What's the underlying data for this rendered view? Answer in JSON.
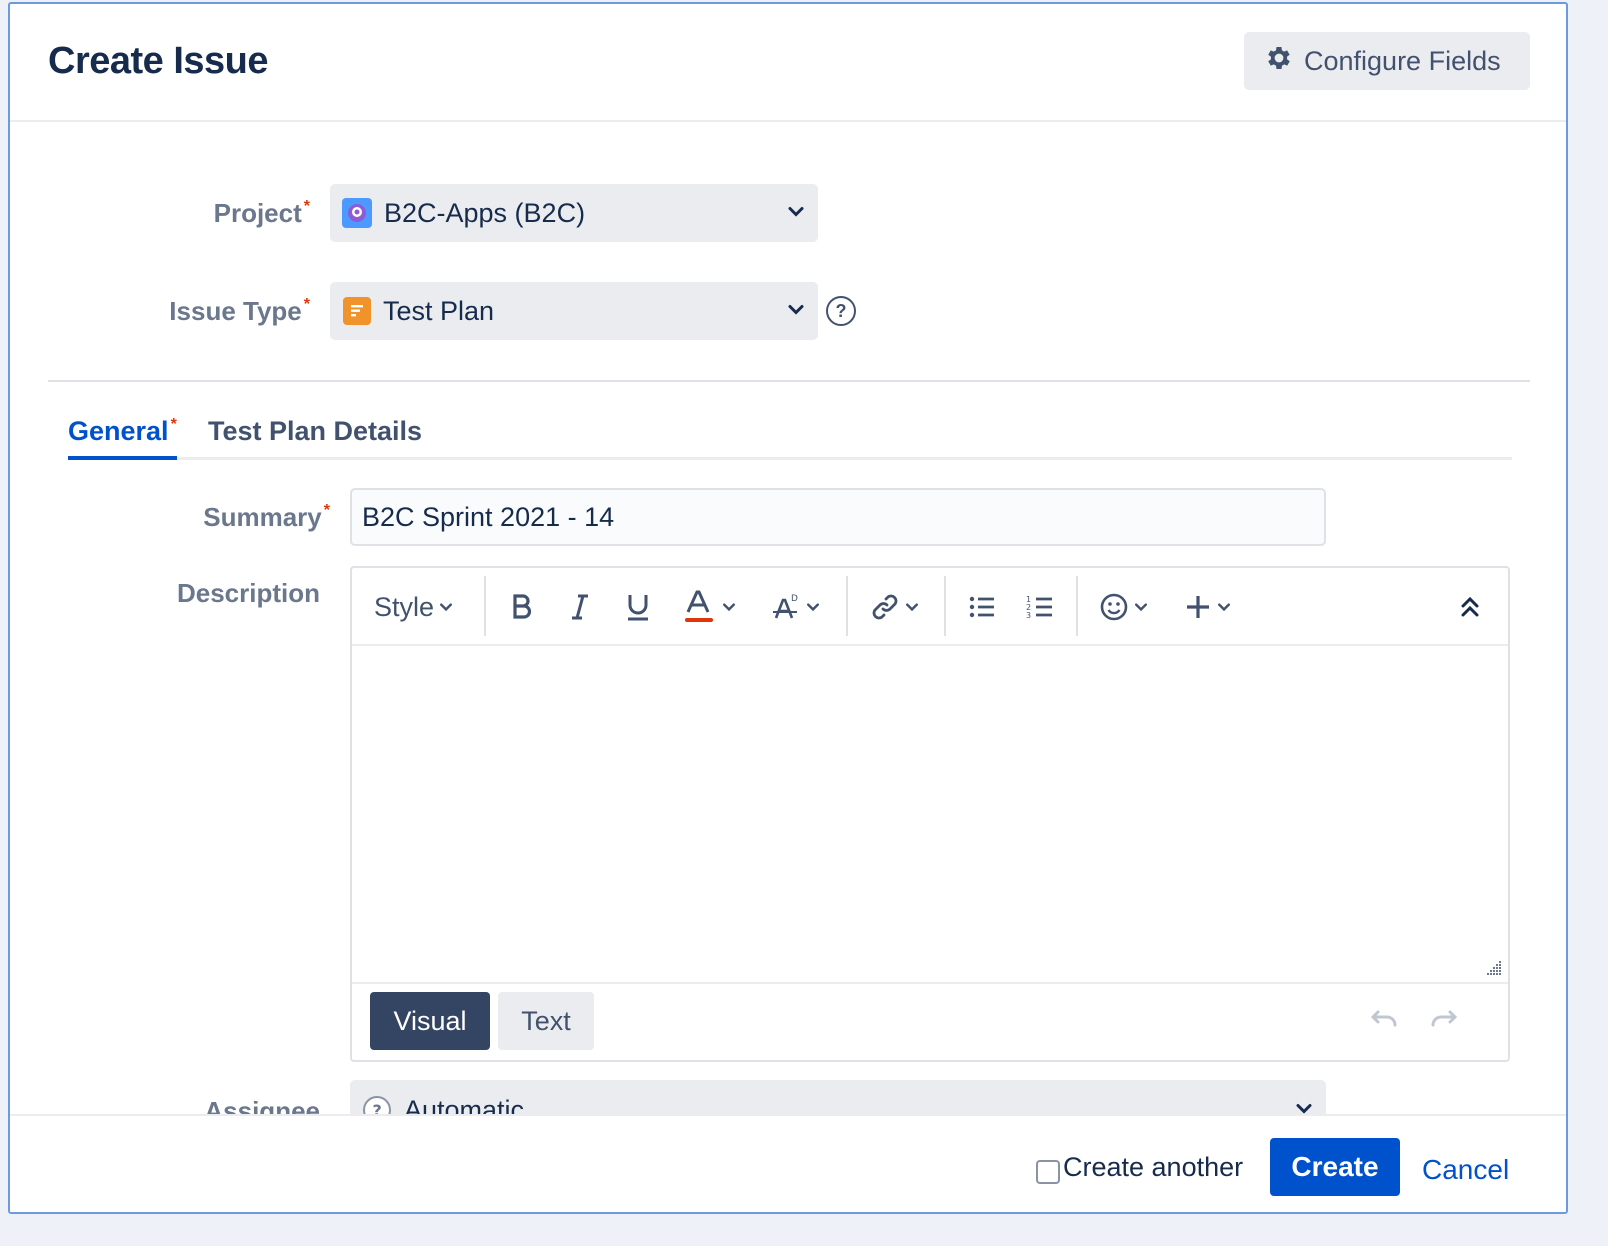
{
  "dialog": {
    "title": "Create Issue",
    "configure_fields_label": "Configure Fields"
  },
  "form": {
    "project": {
      "label": "Project",
      "required_mark": "*",
      "value": "B2C-Apps (B2C)"
    },
    "issue_type": {
      "label": "Issue Type",
      "required_mark": "*",
      "value": "Test Plan"
    },
    "tabs": [
      {
        "label": "General",
        "required_mark": "*",
        "active": true
      },
      {
        "label": "Test Plan Details",
        "active": false
      }
    ],
    "summary": {
      "label": "Summary",
      "required_mark": "*",
      "value": "B2C Sprint 2021 - 14"
    },
    "description": {
      "label": "Description",
      "toolbar": {
        "style_label": "Style"
      },
      "modes": [
        "Visual",
        "Text"
      ],
      "active_mode": "Visual"
    },
    "assignee": {
      "label": "Assignee",
      "value": "Automatic"
    }
  },
  "footer": {
    "create_another_label": "Create another",
    "create_another_checked": false,
    "create_label": "Create",
    "cancel_label": "Cancel"
  },
  "colors": {
    "primary": "#0052cc",
    "required": "#de350b",
    "text_color_underline": "#de350b",
    "issue_type_icon": "#f0932b",
    "project_icon": "#4c9aff"
  }
}
